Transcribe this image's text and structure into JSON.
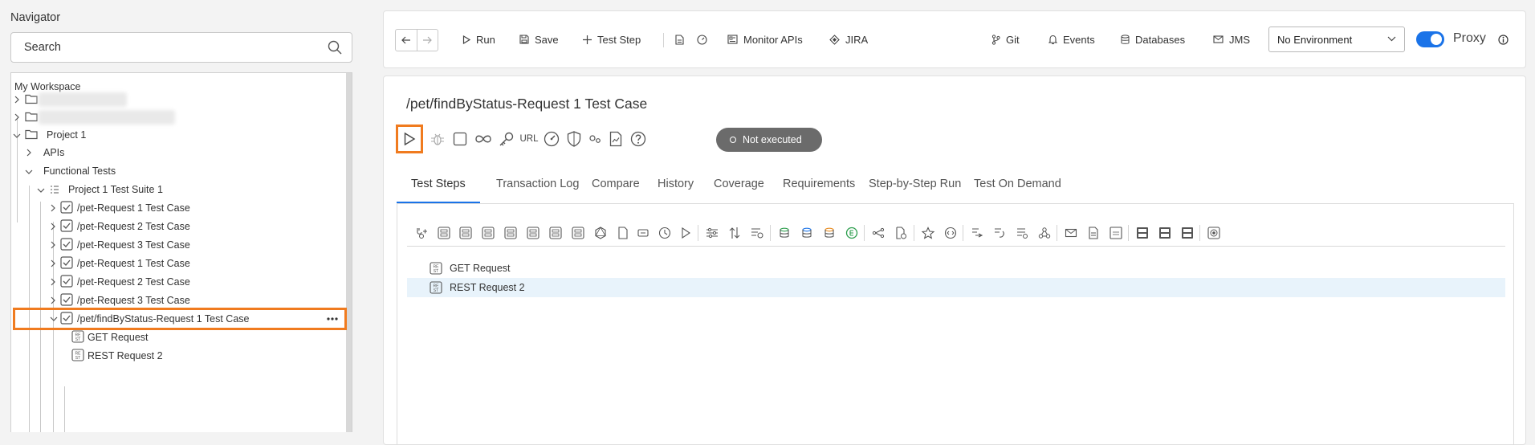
{
  "navigator": {
    "title": "Navigator",
    "search_placeholder": "Search",
    "workspace_label": "My Workspace",
    "project": "Project 1",
    "apis": "APIs",
    "functional_tests": "Functional Tests",
    "suite": "Project 1 Test Suite 1",
    "test_cases": [
      "/pet-Request 1 Test Case",
      "/pet-Request 2 Test Case",
      "/pet-Request 3 Test Case",
      "/pet-Request 1 Test Case",
      "/pet-Request 2 Test Case",
      "/pet-Request 3 Test Case",
      "/pet/findByStatus-Request 1 Test Case"
    ],
    "steps": [
      "GET Request",
      "REST Request 2"
    ]
  },
  "toolbar": {
    "run": "Run",
    "save": "Save",
    "test_step": "Test Step",
    "monitor_apis": "Monitor APIs",
    "jira": "JIRA",
    "git": "Git",
    "events": "Events",
    "databases": "Databases",
    "jms": "JMS",
    "environment": "No Environment",
    "proxy": "Proxy"
  },
  "panel": {
    "title": "/pet/findByStatus-Request 1 Test Case",
    "url_label": "URL",
    "status": "Not executed",
    "tabs": [
      "Test Steps",
      "Transaction Log",
      "Compare",
      "History",
      "Coverage",
      "Requirements",
      "Step-by-Step Run",
      "Test On Demand"
    ],
    "steps": [
      "GET Request",
      "REST Request 2"
    ]
  },
  "colors": {
    "accent": "#1a73e8",
    "highlight": "#f07b1f",
    "status_bg": "#6b6b6b",
    "selected_row": "#e8f3fb"
  }
}
